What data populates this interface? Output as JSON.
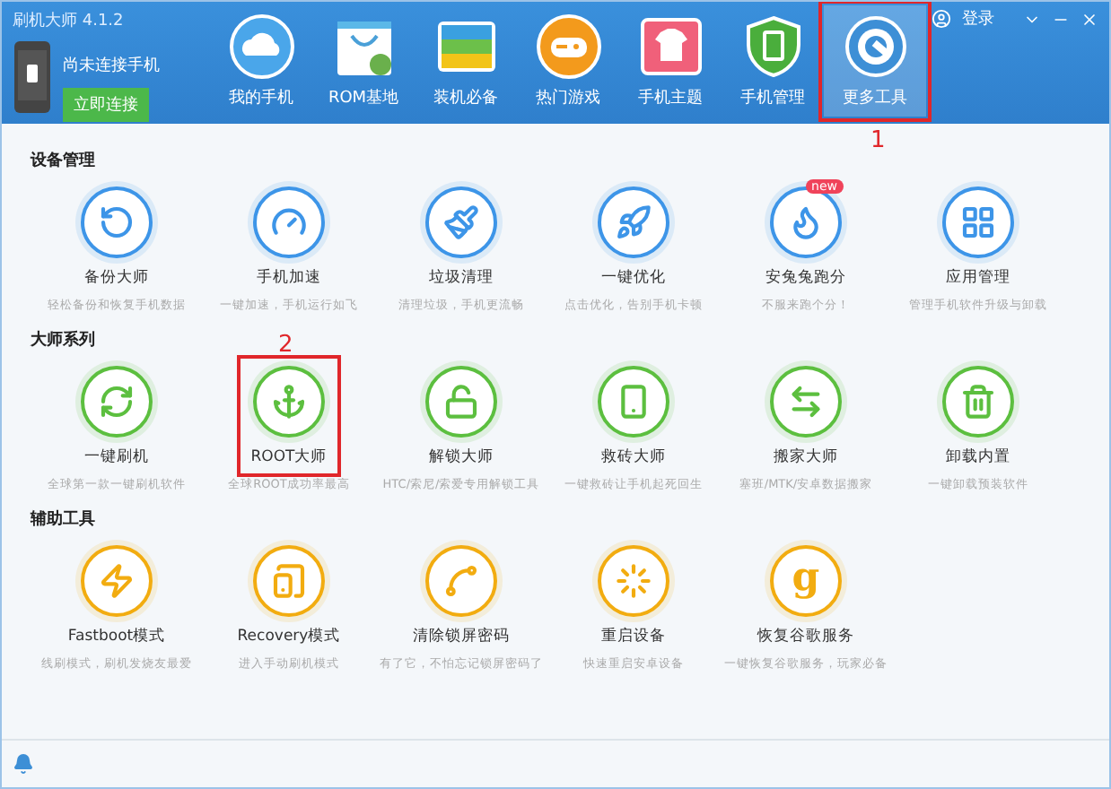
{
  "window": {
    "title": "刷机大师 4.1.2",
    "login": "登录"
  },
  "device": {
    "status": "尚未连接手机",
    "connect_button": "立即连接"
  },
  "nav": [
    {
      "label": "我的手机",
      "selected": false
    },
    {
      "label": "ROM基地",
      "selected": false
    },
    {
      "label": "装机必备",
      "selected": false
    },
    {
      "label": "热门游戏",
      "selected": false
    },
    {
      "label": "手机主题",
      "selected": false
    },
    {
      "label": "手机管理",
      "selected": false
    },
    {
      "label": "更多工具",
      "selected": true,
      "annotation": "1"
    }
  ],
  "sections": [
    {
      "title": "设备管理",
      "color": "#3d95e8",
      "items": [
        {
          "name": "备份大师",
          "desc": "轻松备份和恢复手机数据"
        },
        {
          "name": "手机加速",
          "desc": "一键加速，手机运行如飞"
        },
        {
          "name": "垃圾清理",
          "desc": "清理垃圾，手机更流畅"
        },
        {
          "name": "一键优化",
          "desc": "点击优化，告别手机卡顿"
        },
        {
          "name": "安兔兔跑分",
          "desc": "不服来跑个分！",
          "badge": "new"
        },
        {
          "name": "应用管理",
          "desc": "管理手机软件升级与卸载"
        }
      ]
    },
    {
      "title": "大师系列",
      "color": "#5cbf3f",
      "items": [
        {
          "name": "一键刷机",
          "desc": "全球第一款一键刷机软件"
        },
        {
          "name": "ROOT大师",
          "desc": "全球ROOT成功率最高",
          "annotation": "2"
        },
        {
          "name": "解锁大师",
          "desc": "HTC/索尼/索爱专用解锁工具"
        },
        {
          "name": "救砖大师",
          "desc": "一键救砖让手机起死回生"
        },
        {
          "name": "搬家大师",
          "desc": "塞班/MTK/安卓数据搬家"
        },
        {
          "name": "卸载内置",
          "desc": "一键卸载预装软件"
        }
      ]
    },
    {
      "title": "辅助工具",
      "color": "#f2ac10",
      "items": [
        {
          "name": "Fastboot模式",
          "desc": "线刷模式，刷机发烧友最爱"
        },
        {
          "name": "Recovery模式",
          "desc": "进入手动刷机模式"
        },
        {
          "name": "清除锁屏密码",
          "desc": "有了它，不怕忘记锁屏密码了"
        },
        {
          "name": "重启设备",
          "desc": "快速重启安卓设备"
        },
        {
          "name": "恢复谷歌服务",
          "desc": "一键恢复谷歌服务，玩家必备",
          "glyph": "g"
        }
      ]
    }
  ]
}
